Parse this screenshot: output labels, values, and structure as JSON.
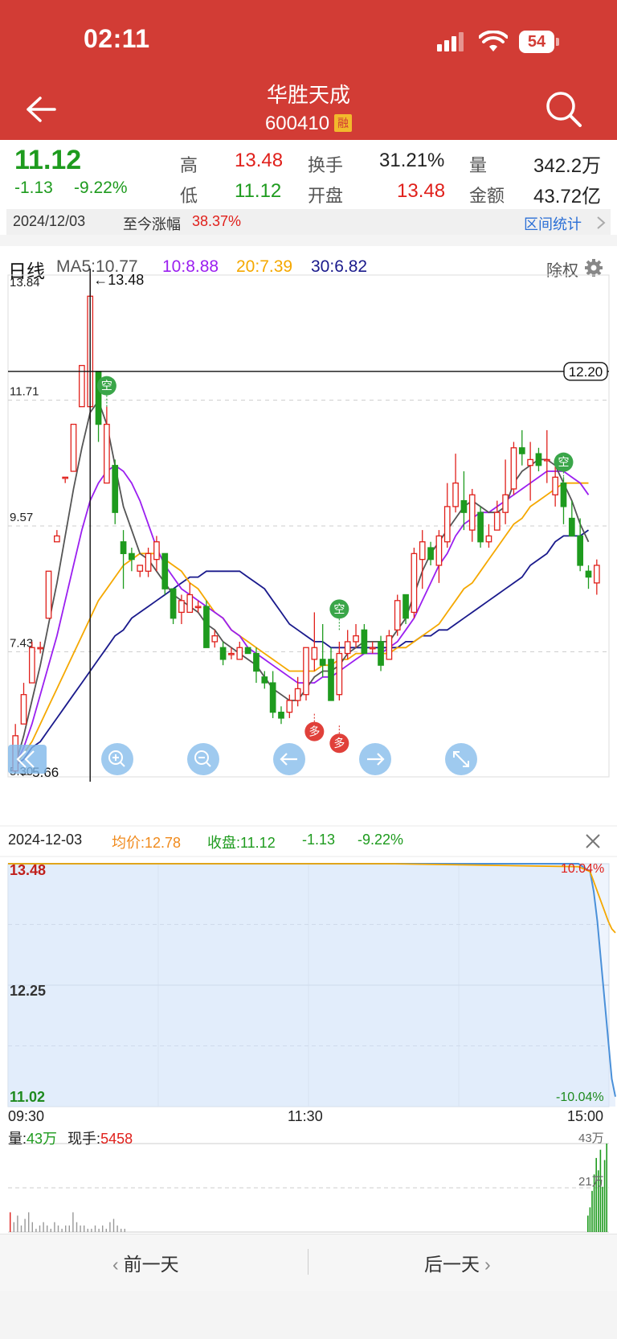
{
  "status_bar": {
    "time": "02:11",
    "battery": "54"
  },
  "header": {
    "title": "华胜天成",
    "code": "600410",
    "badge": "融"
  },
  "quote": {
    "price": "11.12",
    "change": "-1.13",
    "change_pct": "-9.22%",
    "high_label": "高",
    "high_value": "13.48",
    "low_label": "低",
    "low_value": "11.12",
    "turnover_label": "换手",
    "turnover_value": "31.21%",
    "open_label": "开盘",
    "open_value": "13.48",
    "volume_label": "量",
    "volume_value": "342.2万",
    "amount_label": "金额",
    "amount_value": "43.72亿"
  },
  "date_bar": {
    "date": "2024/12/03",
    "since_label": "至今涨幅",
    "since_value": "38.37%",
    "stats_link": "区间统计"
  },
  "kline": {
    "period_label": "日线",
    "ma5": "MA5:10.77",
    "ma10": "10:8.88",
    "ma20": "20:7.39",
    "ma30": "30:6.82",
    "adjust_label": "除权",
    "y_labels": [
      "13.84",
      "11.71",
      "9.57",
      "7.43",
      "5.30"
    ],
    "max_marker": "←13.48",
    "min_marker": "←5.66",
    "cursor_price": "12.20",
    "signal_short": "空",
    "signal_long": "多"
  },
  "info_row": {
    "date": "2024-12-03",
    "avg": "均价:12.78",
    "close": "收盘:11.12",
    "change": "-1.13",
    "change_pct": "-9.22%"
  },
  "intraday": {
    "price_top": "13.48",
    "price_mid": "12.25",
    "price_bottom": "11.02",
    "pct_top": "10.04%",
    "pct_bottom": "-10.04%",
    "time_start": "09:30",
    "time_mid": "11:30",
    "time_end": "15:00",
    "vol_label": "量:",
    "vol_value": "43万",
    "cur_label": "现手:",
    "cur_value": "5458",
    "vol_top": "43万",
    "vol_mid": "21万"
  },
  "bottom_nav": {
    "prev": "前一天",
    "next": "后一天"
  },
  "colors": {
    "header": "#d23c35",
    "up": "#e0201b",
    "down": "#1e9b1e",
    "ma5": "#555555",
    "ma10": "#9b1ff0",
    "ma20": "#f5a800",
    "ma30": "#1a1a8c",
    "line": "#4a90d9"
  },
  "chart_data": {
    "type": "candlestick",
    "y_range": [
      5.3,
      13.84
    ],
    "candles": [
      {
        "o": 5.4,
        "h": 6.2,
        "l": 5.4,
        "c": 6.0
      },
      {
        "o": 6.2,
        "h": 6.9,
        "l": 6.2,
        "c": 6.7
      },
      {
        "o": 6.9,
        "h": 7.6,
        "l": 6.9,
        "c": 7.5
      },
      {
        "o": 7.5,
        "h": 7.6,
        "l": 7.4,
        "c": 7.5
      },
      {
        "o": 8.0,
        "h": 8.8,
        "l": 8.0,
        "c": 8.8
      },
      {
        "o": 9.3,
        "h": 9.5,
        "l": 9.3,
        "c": 9.4
      },
      {
        "o": 10.4,
        "h": 10.4,
        "l": 10.3,
        "c": 10.4
      },
      {
        "o": 10.5,
        "h": 11.3,
        "l": 10.5,
        "c": 11.3
      },
      {
        "o": 11.6,
        "h": 12.3,
        "l": 11.6,
        "c": 12.3
      },
      {
        "o": 11.6,
        "h": 13.84,
        "l": 11.3,
        "c": 13.48
      },
      {
        "o": 12.2,
        "h": 12.2,
        "l": 11.0,
        "c": 11.3
      },
      {
        "o": 10.3,
        "h": 11.6,
        "l": 10.3,
        "c": 11.3
      },
      {
        "o": 10.6,
        "h": 10.7,
        "l": 9.6,
        "c": 9.8
      },
      {
        "o": 9.3,
        "h": 9.5,
        "l": 8.5,
        "c": 9.1
      },
      {
        "o": 9.1,
        "h": 9.2,
        "l": 8.8,
        "c": 9.0
      },
      {
        "o": 8.8,
        "h": 8.9,
        "l": 8.7,
        "c": 8.9
      },
      {
        "o": 8.8,
        "h": 9.2,
        "l": 8.7,
        "c": 9.1
      },
      {
        "o": 9.0,
        "h": 9.4,
        "l": 8.8,
        "c": 9.3
      },
      {
        "o": 9.1,
        "h": 9.1,
        "l": 8.4,
        "c": 8.5
      },
      {
        "o": 8.5,
        "h": 8.5,
        "l": 7.9,
        "c": 8.0
      },
      {
        "o": 8.1,
        "h": 8.4,
        "l": 7.9,
        "c": 8.3
      },
      {
        "o": 8.1,
        "h": 8.6,
        "l": 8.1,
        "c": 8.4
      },
      {
        "o": 8.2,
        "h": 8.3,
        "l": 8.1,
        "c": 8.2
      },
      {
        "o": 8.2,
        "h": 8.3,
        "l": 7.5,
        "c": 7.5
      },
      {
        "o": 7.6,
        "h": 7.8,
        "l": 7.5,
        "c": 7.7
      },
      {
        "o": 7.5,
        "h": 7.6,
        "l": 7.2,
        "c": 7.3
      },
      {
        "o": 7.4,
        "h": 7.5,
        "l": 7.3,
        "c": 7.4
      },
      {
        "o": 7.3,
        "h": 7.6,
        "l": 7.3,
        "c": 7.5
      },
      {
        "o": 7.5,
        "h": 7.5,
        "l": 7.4,
        "c": 7.4
      },
      {
        "o": 7.4,
        "h": 7.5,
        "l": 6.9,
        "c": 7.1
      },
      {
        "o": 7.0,
        "h": 7.1,
        "l": 6.8,
        "c": 6.9
      },
      {
        "o": 6.9,
        "h": 7.1,
        "l": 6.3,
        "c": 6.4
      },
      {
        "o": 6.4,
        "h": 6.5,
        "l": 6.2,
        "c": 6.3
      },
      {
        "o": 6.4,
        "h": 6.7,
        "l": 6.3,
        "c": 6.6
      },
      {
        "o": 6.6,
        "h": 7.0,
        "l": 6.5,
        "c": 6.8
      },
      {
        "o": 6.7,
        "h": 7.5,
        "l": 6.6,
        "c": 7.5
      },
      {
        "o": 7.3,
        "h": 8.1,
        "l": 7.1,
        "c": 7.5
      },
      {
        "o": 7.3,
        "h": 7.9,
        "l": 7.0,
        "c": 7.2
      },
      {
        "o": 7.3,
        "h": 7.5,
        "l": 6.6,
        "c": 6.6
      },
      {
        "o": 6.7,
        "h": 7.6,
        "l": 6.6,
        "c": 7.4
      },
      {
        "o": 7.4,
        "h": 7.8,
        "l": 7.3,
        "c": 7.6
      },
      {
        "o": 7.6,
        "h": 7.9,
        "l": 7.5,
        "c": 7.7
      },
      {
        "o": 7.8,
        "h": 7.9,
        "l": 7.4,
        "c": 7.4
      },
      {
        "o": 7.5,
        "h": 7.6,
        "l": 7.4,
        "c": 7.5
      },
      {
        "o": 7.6,
        "h": 7.7,
        "l": 7.1,
        "c": 7.2
      },
      {
        "o": 7.3,
        "h": 7.8,
        "l": 7.3,
        "c": 7.7
      },
      {
        "o": 7.8,
        "h": 8.4,
        "l": 7.7,
        "c": 8.3
      },
      {
        "o": 8.4,
        "h": 8.4,
        "l": 7.9,
        "c": 8.0
      },
      {
        "o": 8.1,
        "h": 9.2,
        "l": 8.0,
        "c": 9.1
      },
      {
        "o": 9.0,
        "h": 9.5,
        "l": 8.5,
        "c": 9.3
      },
      {
        "o": 9.2,
        "h": 9.3,
        "l": 8.9,
        "c": 9.0
      },
      {
        "o": 8.9,
        "h": 9.5,
        "l": 8.6,
        "c": 9.4
      },
      {
        "o": 9.3,
        "h": 10.3,
        "l": 9.2,
        "c": 9.9
      },
      {
        "o": 9.9,
        "h": 10.8,
        "l": 9.8,
        "c": 10.3
      },
      {
        "o": 10.0,
        "h": 10.5,
        "l": 9.5,
        "c": 9.8
      },
      {
        "o": 9.5,
        "h": 10.2,
        "l": 9.3,
        "c": 10.1
      },
      {
        "o": 9.8,
        "h": 9.9,
        "l": 9.2,
        "c": 9.3
      },
      {
        "o": 9.3,
        "h": 9.6,
        "l": 9.2,
        "c": 9.4
      },
      {
        "o": 9.5,
        "h": 10.0,
        "l": 9.5,
        "c": 9.8
      },
      {
        "o": 9.8,
        "h": 10.7,
        "l": 9.6,
        "c": 10.1
      },
      {
        "o": 10.2,
        "h": 11.0,
        "l": 10.1,
        "c": 10.9
      },
      {
        "o": 10.9,
        "h": 11.2,
        "l": 10.6,
        "c": 10.8
      },
      {
        "o": 10.6,
        "h": 11.0,
        "l": 10.0,
        "c": 10.7
      },
      {
        "o": 10.8,
        "h": 10.9,
        "l": 10.5,
        "c": 10.6
      },
      {
        "o": 10.7,
        "h": 11.2,
        "l": 10.3,
        "c": 10.7
      },
      {
        "o": 10.1,
        "h": 10.6,
        "l": 9.9,
        "c": 10.4
      },
      {
        "o": 10.3,
        "h": 10.4,
        "l": 9.6,
        "c": 9.9
      },
      {
        "o": 9.7,
        "h": 10.0,
        "l": 9.4,
        "c": 9.4
      },
      {
        "o": 9.4,
        "h": 9.7,
        "l": 8.8,
        "c": 8.9
      },
      {
        "o": 8.8,
        "h": 8.9,
        "l": 8.5,
        "c": 8.7
      },
      {
        "o": 8.6,
        "h": 9.0,
        "l": 8.4,
        "c": 8.9
      }
    ],
    "ma5": [
      5.5,
      6.0,
      6.6,
      7.2,
      7.9,
      8.6,
      9.4,
      10.2,
      10.9,
      11.5,
      11.7,
      11.3,
      10.6,
      9.9,
      9.5,
      9.1,
      9.0,
      8.8,
      8.6,
      8.4,
      8.3,
      8.2,
      8.1,
      7.9,
      7.8,
      7.6,
      7.5,
      7.4,
      7.3,
      7.2,
      7.0,
      6.8,
      6.7,
      6.6,
      6.6,
      6.8,
      7.0,
      7.1,
      7.1,
      7.2,
      7.4,
      7.5,
      7.6,
      7.6,
      7.6,
      7.6,
      7.8,
      8.0,
      8.4,
      8.8,
      9.1,
      9.3,
      9.5,
      9.7,
      9.9,
      10.0,
      9.9,
      9.8,
      9.8,
      9.9,
      10.3,
      10.5,
      10.6,
      10.7,
      10.7,
      10.6,
      10.3,
      10.0,
      9.6,
      9.3
    ],
    "ma10": [
      5.5,
      5.8,
      6.2,
      6.7,
      7.2,
      7.7,
      8.3,
      8.9,
      9.5,
      10.0,
      10.3,
      10.5,
      10.6,
      10.5,
      10.3,
      10.0,
      9.6,
      9.2,
      8.9,
      8.7,
      8.5,
      8.4,
      8.3,
      8.2,
      8.1,
      8.0,
      7.8,
      7.7,
      7.5,
      7.4,
      7.3,
      7.2,
      7.1,
      7.0,
      6.9,
      6.9,
      6.9,
      7.0,
      7.0,
      7.1,
      7.2,
      7.3,
      7.4,
      7.4,
      7.4,
      7.5,
      7.6,
      7.8,
      8.0,
      8.3,
      8.6,
      8.9,
      9.1,
      9.4,
      9.6,
      9.7,
      9.8,
      9.8,
      9.9,
      10.0,
      10.1,
      10.2,
      10.3,
      10.4,
      10.5,
      10.5,
      10.5,
      10.4,
      10.3,
      10.1
    ],
    "ma20": [
      5.5,
      5.7,
      5.9,
      6.2,
      6.5,
      6.8,
      7.1,
      7.4,
      7.7,
      8.0,
      8.3,
      8.5,
      8.7,
      8.9,
      9.0,
      9.1,
      9.1,
      9.1,
      9.0,
      8.9,
      8.8,
      8.6,
      8.5,
      8.3,
      8.1,
      8.0,
      7.8,
      7.7,
      7.6,
      7.5,
      7.4,
      7.3,
      7.2,
      7.1,
      7.1,
      7.1,
      7.1,
      7.2,
      7.2,
      7.3,
      7.3,
      7.4,
      7.4,
      7.4,
      7.4,
      7.4,
      7.5,
      7.5,
      7.6,
      7.7,
      7.8,
      7.9,
      8.1,
      8.3,
      8.5,
      8.6,
      8.8,
      9.0,
      9.2,
      9.4,
      9.6,
      9.7,
      9.9,
      10.0,
      10.1,
      10.2,
      10.3,
      10.3,
      10.3,
      10.3
    ],
    "ma30": [
      5.5,
      5.6,
      5.8,
      5.9,
      6.1,
      6.3,
      6.5,
      6.7,
      6.9,
      7.1,
      7.3,
      7.5,
      7.7,
      7.8,
      8.0,
      8.1,
      8.2,
      8.3,
      8.4,
      8.5,
      8.6,
      8.7,
      8.7,
      8.8,
      8.8,
      8.8,
      8.8,
      8.8,
      8.7,
      8.6,
      8.5,
      8.3,
      8.1,
      7.9,
      7.8,
      7.7,
      7.6,
      7.6,
      7.5,
      7.5,
      7.5,
      7.5,
      7.5,
      7.5,
      7.5,
      7.5,
      7.5,
      7.6,
      7.6,
      7.7,
      7.7,
      7.8,
      7.8,
      7.9,
      8.0,
      8.1,
      8.2,
      8.3,
      8.4,
      8.5,
      8.6,
      8.7,
      8.9,
      9.0,
      9.1,
      9.3,
      9.4,
      9.4,
      9.4,
      9.5
    ],
    "intraday_price": [
      13.48,
      13.48,
      13.48,
      13.48,
      13.4,
      13.2,
      12.9,
      12.5,
      12.1,
      11.7,
      11.3,
      11.12
    ],
    "intraday_avg": [
      13.48,
      13.48,
      13.48,
      13.45,
      13.4,
      13.3,
      13.2,
      13.1,
      13.0,
      12.9,
      12.82,
      12.78
    ],
    "volumes_early": [
      6,
      3,
      5,
      2,
      4,
      6,
      3,
      1,
      2,
      3,
      2,
      1,
      3,
      2,
      1,
      2,
      2,
      6,
      3,
      2,
      2,
      1,
      1,
      2,
      1,
      2,
      1,
      3,
      4,
      2,
      1,
      1
    ],
    "volumes_late": [
      8,
      12,
      20,
      28,
      36,
      30,
      40,
      22,
      35,
      43
    ]
  }
}
